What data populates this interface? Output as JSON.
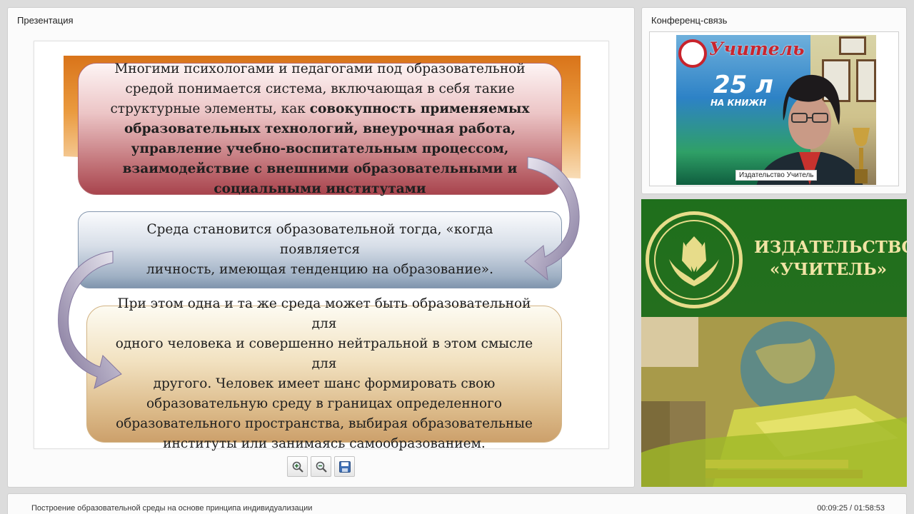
{
  "presentation": {
    "title": "Презентация",
    "slide": {
      "box1": {
        "line1": "Многими психологами и педагогами под образовательной",
        "line2": "средой понимается система, включающая в себя такие",
        "line3_plain": "структурные элементы, как ",
        "line3_bold": "совокупность применяемых",
        "line4": "образовательных технологий, внеурочная работа,",
        "line5": "управление учебно-воспитательным процессом,",
        "line6": "взаимодействие с внешними образовательными и",
        "line7": "социальными институтами"
      },
      "box2": {
        "line1": "Среда становится образовательной тогда, «когда появляется",
        "line2": "личность, имеющая тенденцию на образование»."
      },
      "box3": {
        "line1": "При этом одна и та же среда может быть образовательной для",
        "line2": "одного человека и совершенно нейтральной в этом смысле для",
        "line3": "другого. Человек имеет шанс формировать свою",
        "line4": "образовательную среду в границах определенного",
        "line5": "образовательного пространства, выбирая образовательные",
        "line6": "институты или занимаясь самообразованием."
      }
    },
    "toolbar": {
      "zoom_in_icon": "zoom-in-icon",
      "zoom_out_icon": "zoom-out-icon",
      "save_icon": "save-icon"
    }
  },
  "conference": {
    "title": "Конференц-связь",
    "speaker_name": "Издательство Учитель",
    "poster_word": "Учитель",
    "poster_number": "25 л",
    "poster_sub": "НА КНИЖН"
  },
  "publisher_ad": {
    "line1": "ИЗДАТЕЛЬСТВО",
    "line2": "«УЧИТЕЛЬ»"
  },
  "footer": {
    "lecture_title": "Построение образовательной среды на основе принципа индивидуализации",
    "time": "00:09:25 / 01:58:53"
  },
  "colors": {
    "background": "#dcdcdc",
    "publisher_green": "#1f6f1c",
    "publisher_gold": "#f1e4a5",
    "box1_fill": "#c4777c",
    "box2_fill": "#9fb0c4",
    "box3_fill": "#dbb988",
    "orange_band": "#ea9a3e"
  }
}
